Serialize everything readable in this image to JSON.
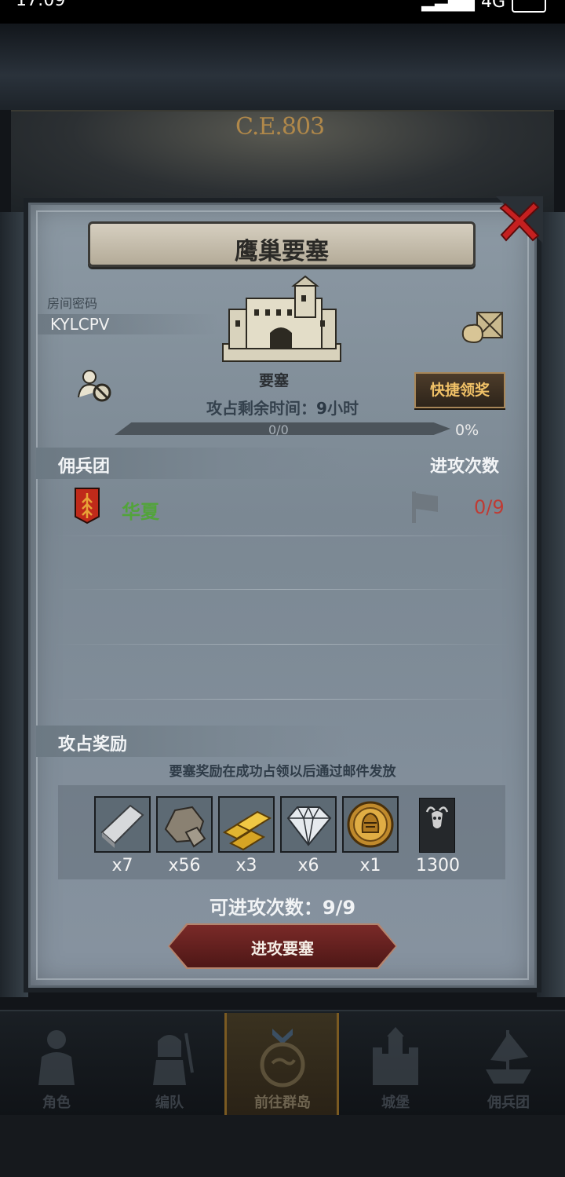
{
  "status_bar": {
    "time": "17:09",
    "network": "4G",
    "battery": "97"
  },
  "background": {
    "era_label": "C.E.803"
  },
  "modal": {
    "title": "鹰巢要塞",
    "room_password_label": "房间密码",
    "room_code": "KYLCPV",
    "fortress_label": "要塞",
    "quick_claim_label": "快捷领奖",
    "time_label": "攻占剩余时间：",
    "time_value": "9",
    "time_unit": "小时",
    "progress_text": "0/0",
    "progress_percent": "0%",
    "progress_fraction": 0,
    "mercenary_section": "佣兵团",
    "attack_count_header": "进攻次数",
    "guilds": [
      {
        "name": "华夏",
        "attacks": "0/9"
      }
    ],
    "rewards_section": "攻占奖励",
    "reward_note": "要塞奖励在成功占领以后通过邮件发放",
    "rewards": [
      {
        "icon": "silver-ingot-icon",
        "qty": "x7"
      },
      {
        "icon": "ore-icon",
        "qty": "x56"
      },
      {
        "icon": "gold-bars-icon",
        "qty": "x3"
      },
      {
        "icon": "diamond-icon",
        "qty": "x6"
      },
      {
        "icon": "knight-coin-icon",
        "qty": "x1"
      },
      {
        "icon": "honor-banner-icon",
        "qty": "1300"
      }
    ],
    "remaining_attacks_label": "可进攻次数：9/9",
    "attack_button": "进攻要塞"
  },
  "bottom_nav": {
    "tabs": [
      {
        "label": "角色",
        "icon": "character-icon",
        "active": false
      },
      {
        "label": "编队",
        "icon": "formation-icon",
        "active": false
      },
      {
        "label": "前往群岛",
        "icon": "islands-compass-icon",
        "active": true
      },
      {
        "label": "城堡",
        "icon": "castle-icon",
        "active": false
      },
      {
        "label": "佣兵团",
        "icon": "mercenary-ship-icon",
        "active": false
      }
    ]
  },
  "colors": {
    "accent_gold": "#f0c167",
    "guild_green": "#52a43a",
    "attack_red": "#bf3b34",
    "button_red": "#7a2a28"
  }
}
